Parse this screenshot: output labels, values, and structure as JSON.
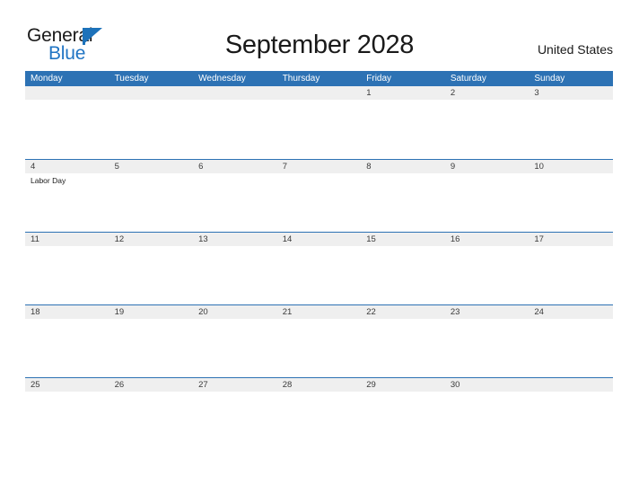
{
  "brand": {
    "name_part1": "General",
    "name_part2": "Blue",
    "triangle_color": "#1d72ba",
    "blue_text_color": "#2175c4"
  },
  "header": {
    "title": "September 2028",
    "region": "United States"
  },
  "theme": {
    "header_blue": "#2d72b4",
    "date_strip_gray": "#efefef",
    "cell_white": "#ffffff",
    "text_dark": "#1a1a1a"
  },
  "calendar": {
    "month": "September",
    "year": "2028",
    "weekday_headers": [
      "Monday",
      "Tuesday",
      "Wednesday",
      "Thursday",
      "Friday",
      "Saturday",
      "Sunday"
    ],
    "weeks": [
      [
        {
          "day": "",
          "events": []
        },
        {
          "day": "",
          "events": []
        },
        {
          "day": "",
          "events": []
        },
        {
          "day": "",
          "events": []
        },
        {
          "day": "1",
          "events": []
        },
        {
          "day": "2",
          "events": []
        },
        {
          "day": "3",
          "events": []
        }
      ],
      [
        {
          "day": "4",
          "events": [
            "Labor Day"
          ]
        },
        {
          "day": "5",
          "events": []
        },
        {
          "day": "6",
          "events": []
        },
        {
          "day": "7",
          "events": []
        },
        {
          "day": "8",
          "events": []
        },
        {
          "day": "9",
          "events": []
        },
        {
          "day": "10",
          "events": []
        }
      ],
      [
        {
          "day": "11",
          "events": []
        },
        {
          "day": "12",
          "events": []
        },
        {
          "day": "13",
          "events": []
        },
        {
          "day": "14",
          "events": []
        },
        {
          "day": "15",
          "events": []
        },
        {
          "day": "16",
          "events": []
        },
        {
          "day": "17",
          "events": []
        }
      ],
      [
        {
          "day": "18",
          "events": []
        },
        {
          "day": "19",
          "events": []
        },
        {
          "day": "20",
          "events": []
        },
        {
          "day": "21",
          "events": []
        },
        {
          "day": "22",
          "events": []
        },
        {
          "day": "23",
          "events": []
        },
        {
          "day": "24",
          "events": []
        }
      ],
      [
        {
          "day": "25",
          "events": []
        },
        {
          "day": "26",
          "events": []
        },
        {
          "day": "27",
          "events": []
        },
        {
          "day": "28",
          "events": []
        },
        {
          "day": "29",
          "events": []
        },
        {
          "day": "30",
          "events": []
        },
        {
          "day": "",
          "events": []
        }
      ]
    ]
  }
}
